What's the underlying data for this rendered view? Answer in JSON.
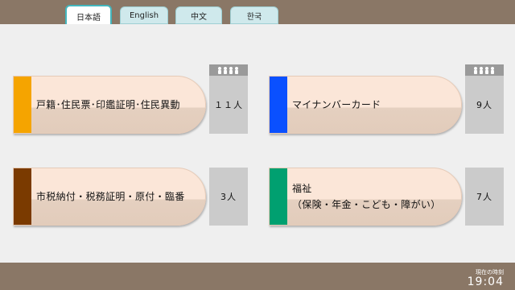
{
  "tabs": [
    {
      "label": "日本語",
      "active": true
    },
    {
      "label": "English",
      "active": false
    },
    {
      "label": "中文",
      "active": false
    },
    {
      "label": "한국",
      "active": false
    }
  ],
  "services": [
    {
      "label_line1": "戸籍･住民票･印鑑証明･住民異動",
      "label_line2": "",
      "waiting": "１１人",
      "color": "#f5a400"
    },
    {
      "label_line1": "マイナンバーカード",
      "label_line2": "",
      "waiting": "9人",
      "color": "#0a50ff"
    },
    {
      "label_line1": "市税納付・税務証明・原付・臨番",
      "label_line2": "",
      "waiting": "3人",
      "color": "#7a3a00"
    },
    {
      "label_line1": "福祉",
      "label_line2": "（保険・年金・こども・障がい）",
      "waiting": "7人",
      "color": "#00a070"
    }
  ],
  "people_icon": "people-group-icon",
  "clock": {
    "caption": "現在の時刻",
    "time": "19:04"
  }
}
